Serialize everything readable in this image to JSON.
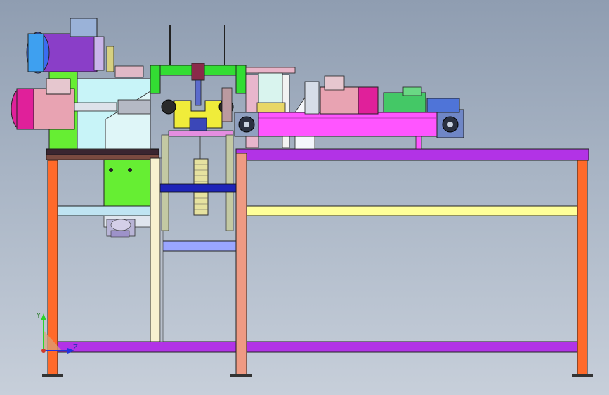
{
  "view": {
    "background_top": "#8f9db1",
    "background_bottom": "#c7cfda"
  },
  "triad": {
    "y_label": "Y",
    "z_label": "Z",
    "y_color": "#2bd32b",
    "z_color": "#2233dd",
    "origin_color": "#d03a2a"
  },
  "colors": {
    "frame_leg_orange": "#ff6a2a",
    "frame_leg_salmon": "#ef9a83",
    "frame_beam_purple": "#b233e6",
    "left_table_top": "#3a2530",
    "crossbar_yellow": "#ffff99",
    "crossbar_cyan": "#bfe4f2",
    "crossbar_blue": "#9aa6ff",
    "cream_post": "#f8f1cf",
    "support_green": "#66ee33",
    "motor_blue": "#3b6cf0",
    "motor_magenta": "#e0209a",
    "motor_pink": "#e8a3b2",
    "conveyor_magenta": "#ff55ff",
    "bracket_cyan": "#c8f4f8",
    "frame_green": "#33dd33",
    "gear_yellow": "#f0ec3a",
    "shaft_blue": "#1e24b8",
    "gearbox_green": "#44c866",
    "gearbox_blue": "#4f74d8"
  }
}
